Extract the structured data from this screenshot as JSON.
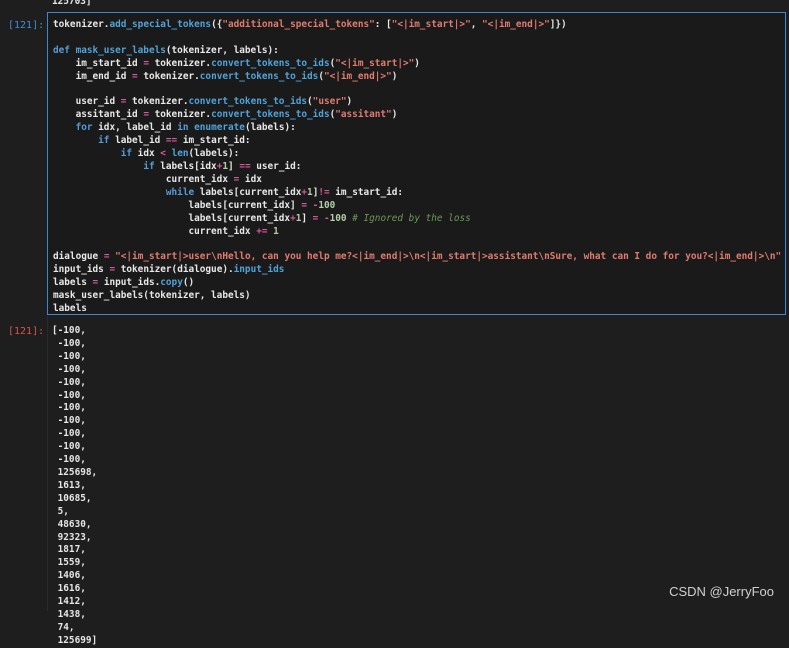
{
  "top_output": {
    "text": "125703]"
  },
  "input_cell": {
    "prompt": "[121]:",
    "lines": [
      [
        {
          "t": "tokenizer."
        },
        {
          "t": "add_special_tokens",
          "c": "f"
        },
        {
          "t": "({"
        },
        {
          "t": "\"additional_special_tokens\"",
          "c": "s"
        },
        {
          "t": ": ["
        },
        {
          "t": "\"<|im_start|>\"",
          "c": "s"
        },
        {
          "t": ", "
        },
        {
          "t": "\"<|im_end|>\"",
          "c": "s"
        },
        {
          "t": "]})"
        }
      ],
      [],
      [
        {
          "t": "def ",
          "c": "k"
        },
        {
          "t": "mask_user_labels",
          "c": "f"
        },
        {
          "t": "(tokenizer, labels):"
        }
      ],
      [
        {
          "t": "    im_start_id "
        },
        {
          "t": "=",
          "c": "o"
        },
        {
          "t": " tokenizer."
        },
        {
          "t": "convert_tokens_to_ids",
          "c": "f"
        },
        {
          "t": "("
        },
        {
          "t": "\"<|im_start|>\"",
          "c": "s"
        },
        {
          "t": ")"
        }
      ],
      [
        {
          "t": "    im_end_id "
        },
        {
          "t": "=",
          "c": "o"
        },
        {
          "t": " tokenizer."
        },
        {
          "t": "convert_tokens_to_ids",
          "c": "f"
        },
        {
          "t": "("
        },
        {
          "t": "\"<|im_end|>\"",
          "c": "s"
        },
        {
          "t": ")"
        }
      ],
      [],
      [
        {
          "t": "    user_id "
        },
        {
          "t": "=",
          "c": "o"
        },
        {
          "t": " tokenizer."
        },
        {
          "t": "convert_tokens_to_ids",
          "c": "f"
        },
        {
          "t": "("
        },
        {
          "t": "\"user\"",
          "c": "s"
        },
        {
          "t": ")"
        }
      ],
      [
        {
          "t": "    assitant_id "
        },
        {
          "t": "=",
          "c": "o"
        },
        {
          "t": " tokenizer."
        },
        {
          "t": "convert_tokens_to_ids",
          "c": "f"
        },
        {
          "t": "("
        },
        {
          "t": "\"assitant\"",
          "c": "s"
        },
        {
          "t": ")"
        }
      ],
      [
        {
          "t": "    "
        },
        {
          "t": "for",
          "c": "k"
        },
        {
          "t": " idx, label_id "
        },
        {
          "t": "in",
          "c": "k"
        },
        {
          "t": " "
        },
        {
          "t": "enumerate",
          "c": "f"
        },
        {
          "t": "(labels):"
        }
      ],
      [
        {
          "t": "        "
        },
        {
          "t": "if",
          "c": "k"
        },
        {
          "t": " label_id "
        },
        {
          "t": "==",
          "c": "o"
        },
        {
          "t": " im_start_id:"
        }
      ],
      [
        {
          "t": "            "
        },
        {
          "t": "if",
          "c": "k"
        },
        {
          "t": " idx "
        },
        {
          "t": "<",
          "c": "o"
        },
        {
          "t": " "
        },
        {
          "t": "len",
          "c": "f"
        },
        {
          "t": "(labels):"
        }
      ],
      [
        {
          "t": "                "
        },
        {
          "t": "if",
          "c": "k"
        },
        {
          "t": " labels[idx"
        },
        {
          "t": "+",
          "c": "o"
        },
        {
          "t": "1",
          "c": "n"
        },
        {
          "t": "] "
        },
        {
          "t": "==",
          "c": "o"
        },
        {
          "t": " user_id:"
        }
      ],
      [
        {
          "t": "                    current_idx "
        },
        {
          "t": "=",
          "c": "o"
        },
        {
          "t": " idx"
        }
      ],
      [
        {
          "t": "                    "
        },
        {
          "t": "while",
          "c": "k"
        },
        {
          "t": " labels[current_idx"
        },
        {
          "t": "+",
          "c": "o"
        },
        {
          "t": "1",
          "c": "n"
        },
        {
          "t": "]"
        },
        {
          "t": "!=",
          "c": "o"
        },
        {
          "t": " im_start_id:"
        }
      ],
      [
        {
          "t": "                        labels[current_idx] "
        },
        {
          "t": "=",
          "c": "o"
        },
        {
          "t": " "
        },
        {
          "t": "-",
          "c": "o"
        },
        {
          "t": "100",
          "c": "n"
        }
      ],
      [
        {
          "t": "                        labels[current_idx"
        },
        {
          "t": "+",
          "c": "o"
        },
        {
          "t": "1",
          "c": "n"
        },
        {
          "t": "] "
        },
        {
          "t": "=",
          "c": "o"
        },
        {
          "t": " "
        },
        {
          "t": "-",
          "c": "o"
        },
        {
          "t": "100",
          "c": "n"
        },
        {
          "t": " "
        },
        {
          "t": "# Ignored by the loss",
          "c": "c"
        }
      ],
      [
        {
          "t": "                        current_idx "
        },
        {
          "t": "+=",
          "c": "o"
        },
        {
          "t": " "
        },
        {
          "t": "1",
          "c": "n"
        }
      ],
      [],
      [
        {
          "t": "dialogue "
        },
        {
          "t": "=",
          "c": "o"
        },
        {
          "t": " "
        },
        {
          "t": "\"<|im_start|>user\\nHello, can you help me?<|im_end|>\\n<|im_start|>assistant\\nSure, what can I do for you?<|im_end|>\\n\"",
          "c": "s"
        }
      ],
      [
        {
          "t": "input_ids "
        },
        {
          "t": "=",
          "c": "o"
        },
        {
          "t": " tokenizer(dialogue)."
        },
        {
          "t": "input_ids",
          "c": "f"
        }
      ],
      [
        {
          "t": "labels "
        },
        {
          "t": "=",
          "c": "o"
        },
        {
          "t": " input_ids."
        },
        {
          "t": "copy",
          "c": "f"
        },
        {
          "t": "()"
        }
      ],
      [
        {
          "t": "mask_user_labels(tokenizer, labels)"
        }
      ],
      [
        {
          "t": "labels"
        }
      ]
    ]
  },
  "output_cell": {
    "prompt": "[121]:",
    "lines": [
      "[-100,",
      " -100,",
      " -100,",
      " -100,",
      " -100,",
      " -100,",
      " -100,",
      " -100,",
      " -100,",
      " -100,",
      " -100,",
      " 125698,",
      " 1613,",
      " 10685,",
      " 5,",
      " 48630,",
      " 92323,",
      " 1817,",
      " 1559,",
      " 1406,",
      " 1616,",
      " 1412,",
      " 1438,",
      " 74,",
      " 125699]"
    ]
  },
  "watermark": "CSDN @JerryFoo"
}
